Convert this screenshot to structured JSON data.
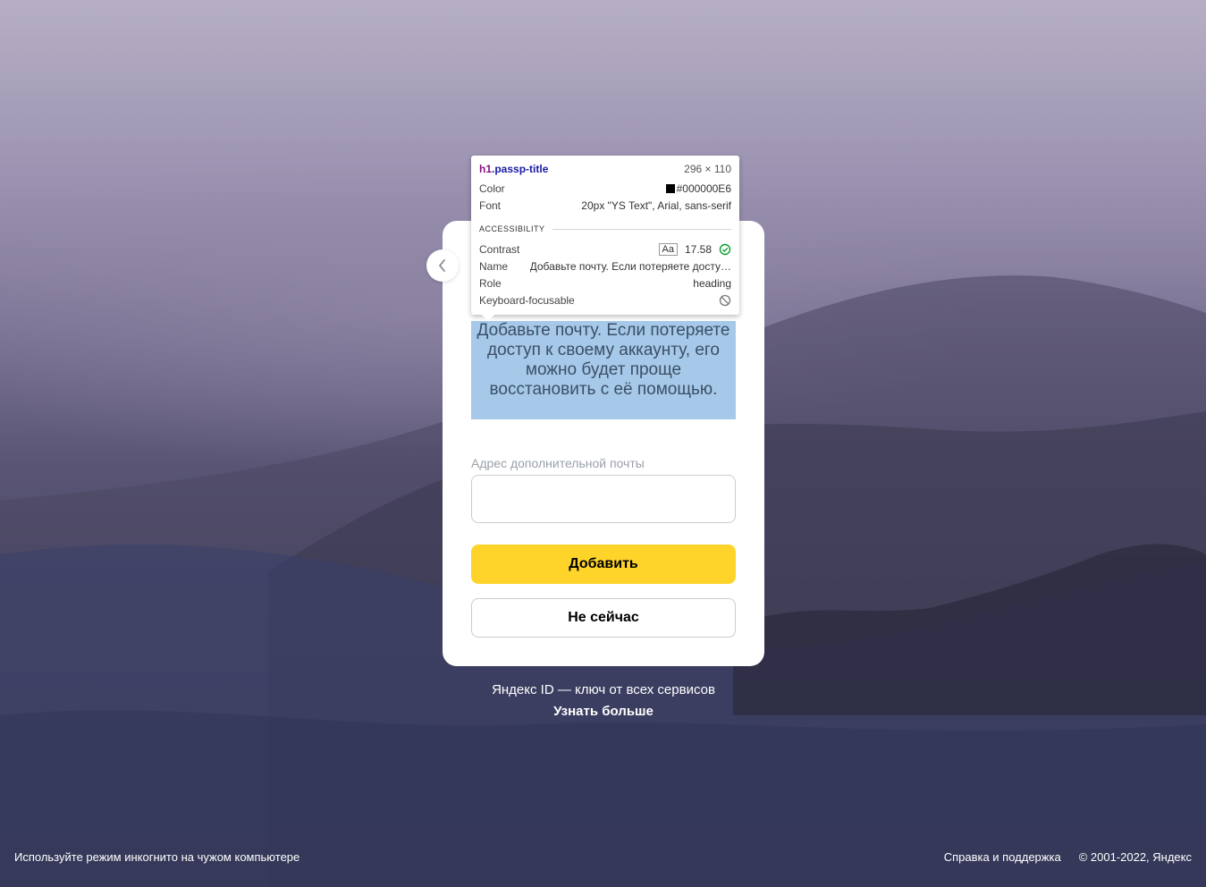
{
  "devtools_tooltip": {
    "selector_tag": "h1",
    "selector_class": ".passp-title",
    "size": "296 × 110",
    "color_label": "Color",
    "color_value": "#000000E6",
    "font_label": "Font",
    "font_value": "20px \"YS Text\", Arial, sans-serif",
    "section_title": "ACCESSIBILITY",
    "contrast_label": "Contrast",
    "contrast_aa": "Aa",
    "contrast_value": "17.58",
    "name_label": "Name",
    "name_value": "Добавьте почту. Если потеряете досту…",
    "role_label": "Role",
    "role_value": "heading",
    "keyboard_label": "Keyboard-focusable"
  },
  "form": {
    "title": "Добавьте почту. Если потеряете доступ к своему аккаунту, его можно будет проще восстановить с её помощью.",
    "email_label": "Адрес дополнительной почты",
    "email_value": "",
    "add_button": "Добавить",
    "skip_button": "Не сейчас"
  },
  "promo": {
    "text": "Яндекс ID — ключ от всех сервисов",
    "link": "Узнать больше"
  },
  "footer": {
    "left": "Используйте режим инкогнито на чужом компьютере",
    "help": "Справка и поддержка",
    "copyright": "© 2001-2022, Яндекс"
  },
  "colors": {
    "primary_button": "#fed42b",
    "highlight": "#6fa8dc"
  },
  "icons": {
    "back": "chevron-left-icon",
    "contrast_ok": "check-circle-icon",
    "not_focusable": "no-entry-icon",
    "color_swatch": "black-square"
  }
}
